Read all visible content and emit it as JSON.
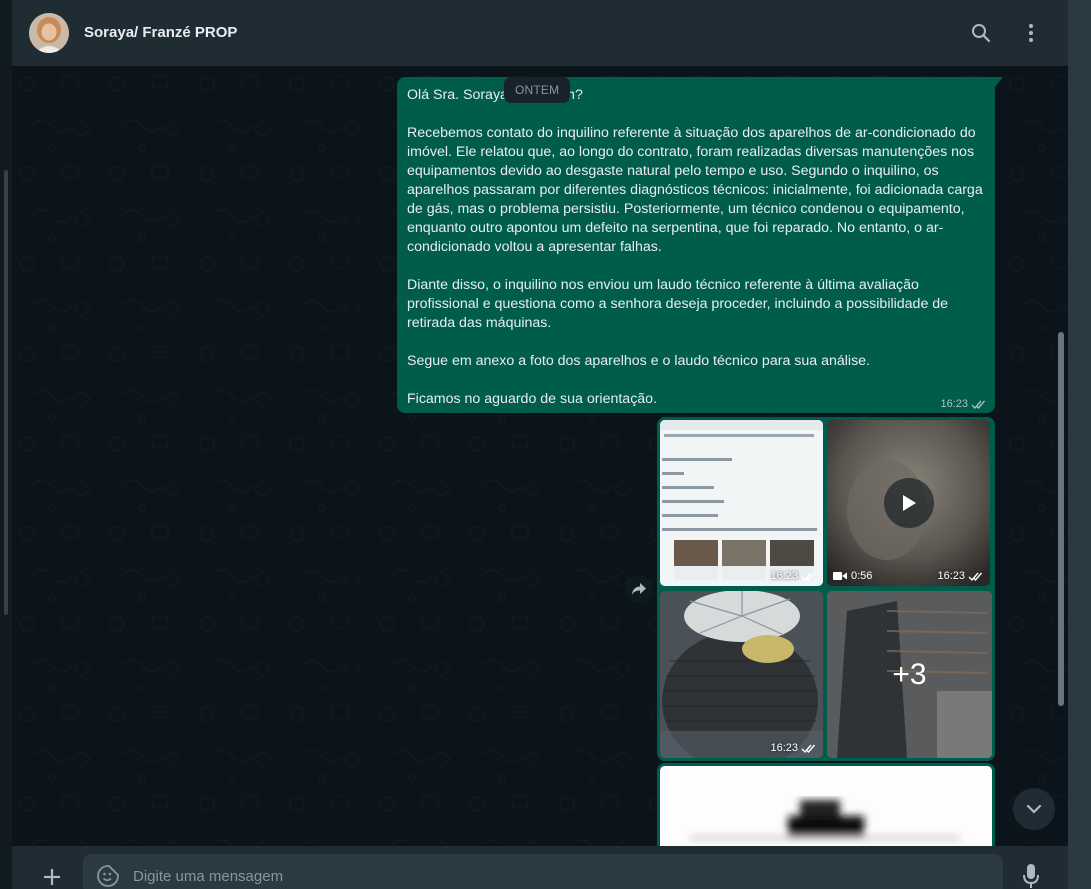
{
  "header": {
    "contact_name": "Soraya/ Franzé PROP",
    "avatar_icon": "contact-avatar",
    "search_icon": "search-icon",
    "menu_icon": "more-vertical-icon"
  },
  "chat": {
    "date_label": "ONTEM",
    "message": {
      "paragraphs": [
        "Olá Sra. Soraya, tudo bem?",
        "Recebemos contato do inquilino referente à situação dos aparelhos de ar-condicionado do imóvel. Ele relatou que, ao longo do contrato, foram realizadas diversas manutenções nos equipamentos devido ao desgaste natural pelo tempo e uso. Segundo o inquilino, os aparelhos passaram por diferentes diagnósticos técnicos: inicialmente, foi adicionada carga de gás, mas o problema persistiu. Posteriormente, um técnico condenou o equipamento, enquanto outro apontou um defeito na serpentina, que foi reparado. No entanto, o ar-condicionado voltou a apresentar falhas.",
        "Diante disso, o inquilino nos enviou um laudo técnico referente à última avaliação profissional e questiona como a senhora deseja proceder, incluindo a possibilidade de retirada das máquinas.",
        "Segue em anexo a foto dos aparelhos e o laudo técnico para sua análise.",
        "Ficamos no aguardo de sua orientação."
      ],
      "time": "16:23",
      "status": "read"
    },
    "album": {
      "tiles": [
        {
          "kind": "document-screenshot",
          "time": "16:23"
        },
        {
          "kind": "video",
          "duration": "0:56",
          "time": "16:23"
        },
        {
          "kind": "photo",
          "time": "16:23"
        },
        {
          "kind": "photo-more",
          "more_label": "+3"
        }
      ]
    }
  },
  "composer": {
    "placeholder": "Digite uma mensagem",
    "attach_icon": "plus-icon",
    "emoji_icon": "sticker-icon",
    "mic_icon": "microphone-icon"
  },
  "colors": {
    "outgoing_bubble": "#005c4b",
    "chat_bg": "#0b141a",
    "header_bg": "#202c33",
    "input_bg": "#2a3942",
    "text_primary": "#e9edef",
    "text_secondary": "#8696a0"
  }
}
